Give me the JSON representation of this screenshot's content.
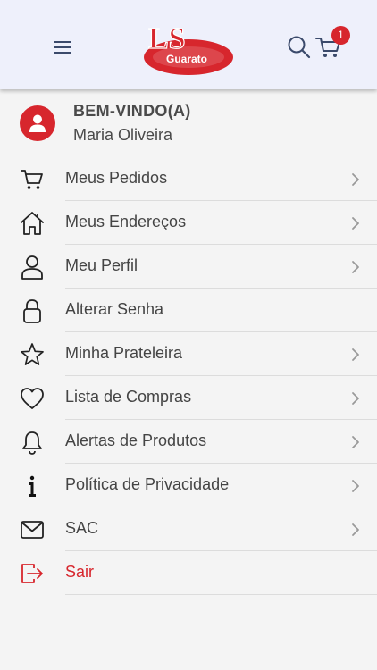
{
  "header": {
    "logo_main": "LS",
    "logo_sub": "Guarato",
    "cart_count": "1",
    "brand_color": "#d7262d",
    "icon_color": "#3b4a6b"
  },
  "user": {
    "welcome": "BEM-VINDO(A)",
    "name": "Maria Oliveira"
  },
  "menu": {
    "items": [
      {
        "label": "Meus Pedidos",
        "icon": "cart-icon",
        "chevron": true
      },
      {
        "label": "Meus Endereços",
        "icon": "home-icon",
        "chevron": true
      },
      {
        "label": "Meu Perfil",
        "icon": "user-icon",
        "chevron": true
      },
      {
        "label": "Alterar Senha",
        "icon": "lock-icon",
        "chevron": false
      },
      {
        "label": "Minha Prateleira",
        "icon": "star-icon",
        "chevron": true
      },
      {
        "label": "Lista de Compras",
        "icon": "heart-icon",
        "chevron": true
      },
      {
        "label": "Alertas de Produtos",
        "icon": "bell-icon",
        "chevron": true
      },
      {
        "label": "Política de Privacidade",
        "icon": "info-icon",
        "chevron": true
      },
      {
        "label": "SAC",
        "icon": "mail-icon",
        "chevron": true
      },
      {
        "label": "Sair",
        "icon": "logout-icon",
        "chevron": false
      }
    ]
  }
}
